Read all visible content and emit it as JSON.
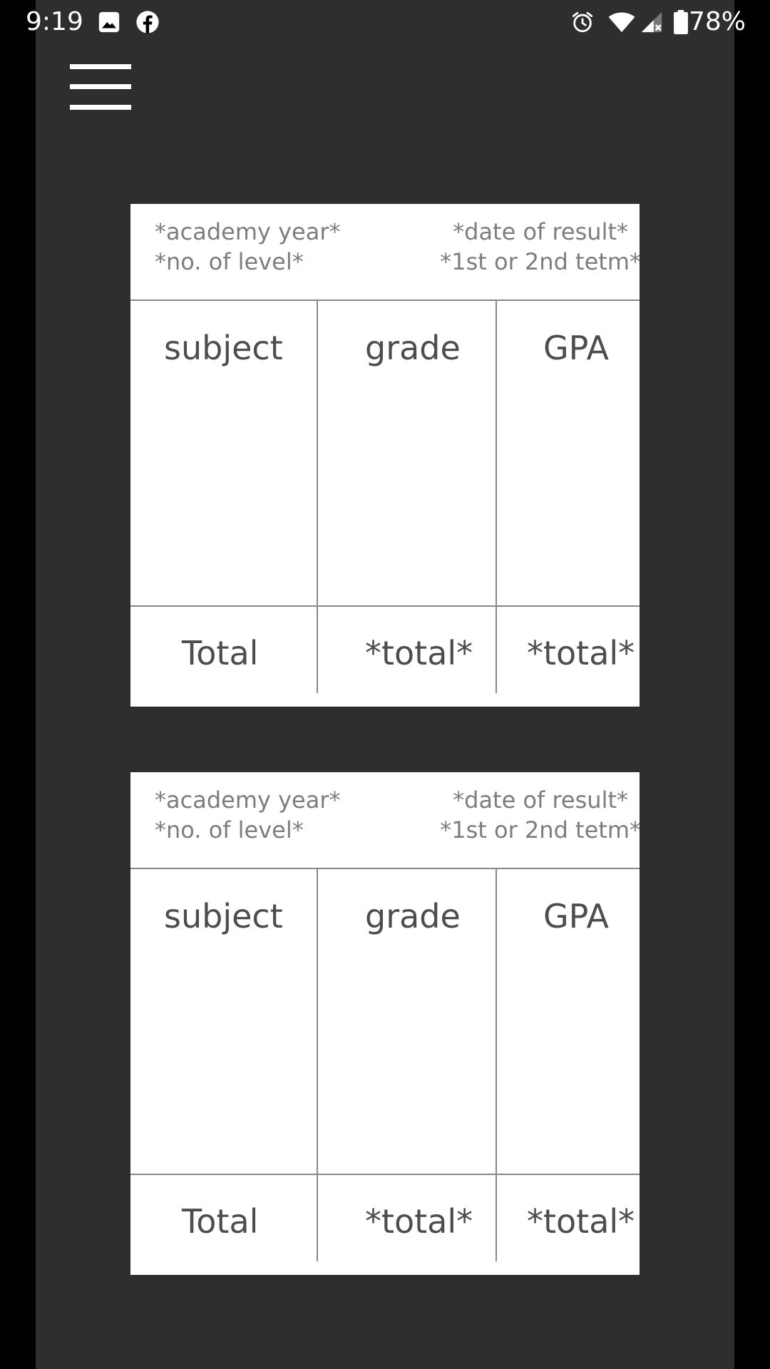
{
  "status_bar": {
    "time": "9:19",
    "battery": "78%",
    "icons": [
      "image-icon",
      "facebook-icon",
      "alarm-icon",
      "wifi-icon",
      "signal-icon",
      "battery-icon"
    ]
  },
  "menu": {
    "icon": "hamburger-menu-icon"
  },
  "cards": [
    {
      "academic_year": "*academy year*",
      "level": "*no. of level*",
      "date": "*date of result*",
      "term": "*1st or 2nd tetm*",
      "headers": {
        "subject": "subject",
        "grade": "grade",
        "gpa": "GPA"
      },
      "footer": {
        "label": "Total",
        "grade_total": "*total*",
        "gpa_total": "*total*"
      }
    },
    {
      "academic_year": "*academy year*",
      "level": "*no. of level*",
      "date": "*date of result*",
      "term": "*1st or 2nd tetm*",
      "headers": {
        "subject": "subject",
        "grade": "grade",
        "gpa": "GPA"
      },
      "footer": {
        "label": "Total",
        "grade_total": "*total*",
        "gpa_total": "*total*"
      }
    }
  ],
  "colors": {
    "app_background": "#2e2e2e",
    "card_background": "#ffffff",
    "text_primary": "#4d4d4d",
    "text_secondary": "#7d7d7d",
    "grid_line": "#888888"
  }
}
